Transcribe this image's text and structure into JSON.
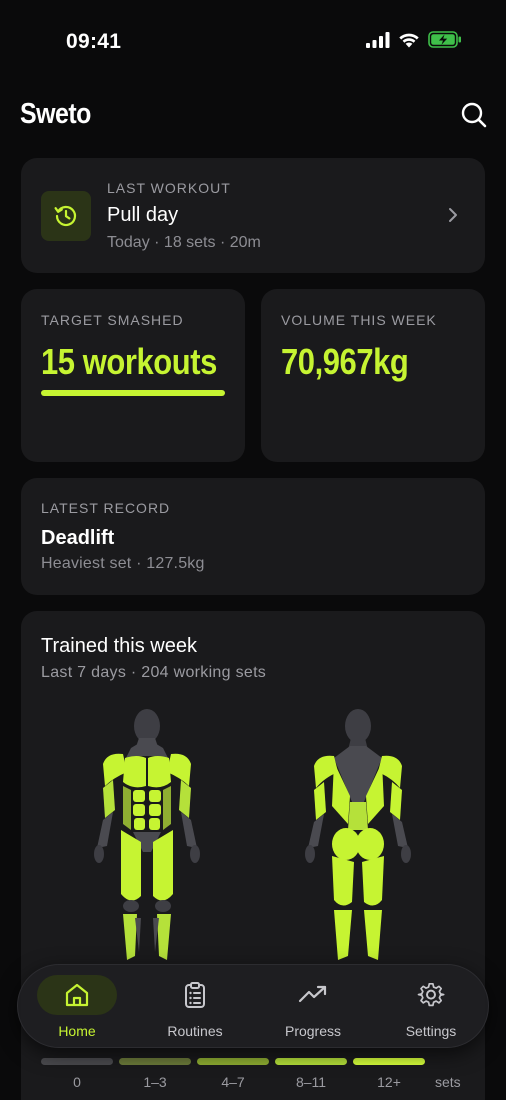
{
  "status_bar": {
    "time": "09:41"
  },
  "header": {
    "title": "Sweto"
  },
  "last_workout": {
    "label": "LAST WORKOUT",
    "title": "Pull day",
    "meta": "Today · 18 sets · 20m"
  },
  "stats": {
    "target": {
      "label": "TARGET SMASHED",
      "value": "15 workouts"
    },
    "volume": {
      "label": "VOLUME THIS WEEK",
      "value": "70,967kg"
    }
  },
  "latest_record": {
    "label": "LATEST RECORD",
    "title": "Deadlift",
    "meta": "Heaviest set · 127.5kg"
  },
  "trained": {
    "title": "Trained this week",
    "meta": "Last 7 days · 204 working sets"
  },
  "legend": {
    "items": [
      {
        "label": "0",
        "color": "#4a4a4e"
      },
      {
        "label": "1–3",
        "color": "#6c7a3a"
      },
      {
        "label": "4–7",
        "color": "#8fae32"
      },
      {
        "label": "8–11",
        "color": "#b5e13a"
      },
      {
        "label": "12+",
        "color": "#d6ff3b"
      }
    ],
    "unit": "sets"
  },
  "tabs": [
    {
      "label": "Home",
      "icon": "home-icon",
      "active": true
    },
    {
      "label": "Routines",
      "icon": "clipboard-list-icon",
      "active": false
    },
    {
      "label": "Progress",
      "icon": "trend-up-icon",
      "active": false
    },
    {
      "label": "Settings",
      "icon": "gear-icon",
      "active": false
    }
  ],
  "colors": {
    "accent": "#c6f432",
    "background": "#0a0a0b",
    "card": "#1a1a1c",
    "muted_text": "#9b9ba1"
  }
}
